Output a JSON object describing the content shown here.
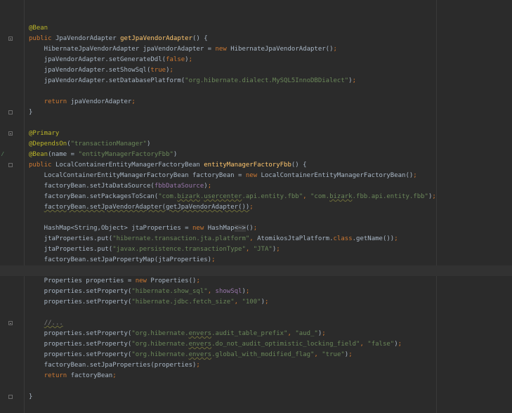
{
  "editor": {
    "lines": [
      {
        "fold": "none",
        "tokens": [
          {
            "t": "@Bean",
            "c": "a"
          }
        ]
      },
      {
        "fold": "open",
        "tokens": [
          {
            "t": "public ",
            "c": "k"
          },
          {
            "t": "JpaVendorAdapter ",
            "c": ""
          },
          {
            "t": "getJpaVendorAdapter",
            "c": "f"
          },
          {
            "t": "() {",
            "c": ""
          }
        ]
      },
      {
        "fold": "none",
        "tokens": [
          {
            "t": "    HibernateJpaVendorAdapter jpaVendorAdapter = ",
            "c": ""
          },
          {
            "t": "new ",
            "c": "k"
          },
          {
            "t": "HibernateJpaVendorAdapter()",
            "c": ""
          },
          {
            "t": ";",
            "c": "k"
          }
        ]
      },
      {
        "fold": "none",
        "tokens": [
          {
            "t": "    jpaVendorAdapter.setGenerateDdl(",
            "c": ""
          },
          {
            "t": "false",
            "c": "k"
          },
          {
            "t": ")",
            "c": ""
          },
          {
            "t": ";",
            "c": "k"
          }
        ]
      },
      {
        "fold": "none",
        "tokens": [
          {
            "t": "    jpaVendorAdapter.setShowSql(",
            "c": ""
          },
          {
            "t": "true",
            "c": "k"
          },
          {
            "t": ")",
            "c": ""
          },
          {
            "t": ";",
            "c": "k"
          }
        ]
      },
      {
        "fold": "none",
        "tokens": [
          {
            "t": "    jpaVendorAdapter.setDatabasePlatform(",
            "c": ""
          },
          {
            "t": "\"org.hibernate.dialect.MySQL5InnoDBDialect\"",
            "c": "s"
          },
          {
            "t": ")",
            "c": ""
          },
          {
            "t": ";",
            "c": "k"
          }
        ]
      },
      {
        "fold": "none",
        "tokens": []
      },
      {
        "fold": "none",
        "tokens": [
          {
            "t": "    ",
            "c": ""
          },
          {
            "t": "return ",
            "c": "k"
          },
          {
            "t": "jpaVendorAdapter",
            "c": ""
          },
          {
            "t": ";",
            "c": "k"
          }
        ]
      },
      {
        "fold": "close",
        "tokens": [
          {
            "t": "}",
            "c": ""
          }
        ]
      },
      {
        "fold": "none",
        "tokens": []
      },
      {
        "fold": "open",
        "tokens": [
          {
            "t": "@Primary",
            "c": "a"
          }
        ]
      },
      {
        "fold": "none",
        "tokens": [
          {
            "t": "@DependsOn",
            "c": "a"
          },
          {
            "t": "(",
            "c": ""
          },
          {
            "t": "\"transactionManager\"",
            "c": "s"
          },
          {
            "t": ")",
            "c": ""
          }
        ]
      },
      {
        "fold": "none",
        "vcs": true,
        "tokens": [
          {
            "t": "@Bean",
            "c": "a"
          },
          {
            "t": "(name = ",
            "c": ""
          },
          {
            "t": "\"entityManagerFactoryFbb\"",
            "c": "s"
          },
          {
            "t": ")",
            "c": ""
          }
        ]
      },
      {
        "fold": "close",
        "tokens": [
          {
            "t": "public ",
            "c": "k"
          },
          {
            "t": "LocalContainerEntityManagerFactoryBean ",
            "c": ""
          },
          {
            "t": "entityManagerFactoryFbb",
            "c": "f"
          },
          {
            "t": "() {",
            "c": ""
          }
        ]
      },
      {
        "fold": "none",
        "tokens": [
          {
            "t": "    LocalContainerEntityManagerFactoryBean factoryBean = ",
            "c": ""
          },
          {
            "t": "new ",
            "c": "k"
          },
          {
            "t": "LocalContainerEntityManagerFactoryBean()",
            "c": ""
          },
          {
            "t": ";",
            "c": "k"
          }
        ]
      },
      {
        "fold": "none",
        "tokens": [
          {
            "t": "    factoryBean.setJtaDataSource(",
            "c": ""
          },
          {
            "t": "fbbDataSource",
            "c": "v"
          },
          {
            "t": ")",
            "c": ""
          },
          {
            "t": ";",
            "c": "k"
          }
        ]
      },
      {
        "fold": "none",
        "tokens": [
          {
            "t": "    factoryBean.setPackagesToScan(",
            "c": ""
          },
          {
            "t": "\"com.",
            "c": "s"
          },
          {
            "t": "bizark",
            "c": "s u"
          },
          {
            "t": ".",
            "c": "s"
          },
          {
            "t": "usercenter",
            "c": "s u"
          },
          {
            "t": ".api.entity.fbb\"",
            "c": "s"
          },
          {
            "t": ", ",
            "c": "k"
          },
          {
            "t": "\"com.",
            "c": "s"
          },
          {
            "t": "bizark",
            "c": "s u"
          },
          {
            "t": ".fbb.api.entity.fbb\"",
            "c": "s"
          },
          {
            "t": ")",
            "c": ""
          },
          {
            "t": ";",
            "c": "k"
          }
        ]
      },
      {
        "fold": "none",
        "tokens": [
          {
            "t": "    ",
            "c": ""
          },
          {
            "t": "factoryBean.setJpaVendorAdapter(getJpaVendorAdapter())",
            "c": "u"
          },
          {
            "t": ";",
            "c": "k"
          }
        ]
      },
      {
        "fold": "none",
        "tokens": []
      },
      {
        "fold": "none",
        "tokens": [
          {
            "t": "    HashMap<String,Object> jtaProperties = ",
            "c": ""
          },
          {
            "t": "new ",
            "c": "k"
          },
          {
            "t": "HashMap",
            "c": ""
          },
          {
            "t": "<~>",
            "c": "hl"
          },
          {
            "t": "()",
            "c": ""
          },
          {
            "t": ";",
            "c": "k"
          }
        ]
      },
      {
        "fold": "none",
        "tokens": [
          {
            "t": "    jtaProperties.put(",
            "c": ""
          },
          {
            "t": "\"hibernate.transaction.jta.platform\"",
            "c": "s"
          },
          {
            "t": ", ",
            "c": "k"
          },
          {
            "t": "AtomikosJtaPlatform.",
            "c": ""
          },
          {
            "t": "class",
            "c": "k"
          },
          {
            "t": ".getName())",
            "c": ""
          },
          {
            "t": ";",
            "c": "k"
          }
        ]
      },
      {
        "fold": "none",
        "tokens": [
          {
            "t": "    jtaProperties.put(",
            "c": ""
          },
          {
            "t": "\"javax.persistence.transactionType\"",
            "c": "s"
          },
          {
            "t": ", ",
            "c": "k"
          },
          {
            "t": "\"JTA\"",
            "c": "s"
          },
          {
            "t": ")",
            "c": ""
          },
          {
            "t": ";",
            "c": "k"
          }
        ]
      },
      {
        "fold": "none",
        "tokens": [
          {
            "t": "    factoryBean.setJpaPropertyMap(jtaProperties)",
            "c": ""
          },
          {
            "t": ";",
            "c": "k"
          }
        ]
      },
      {
        "fold": "none",
        "current": true,
        "tokens": []
      },
      {
        "fold": "none",
        "tokens": [
          {
            "t": "    Properties properties = ",
            "c": ""
          },
          {
            "t": "new ",
            "c": "k"
          },
          {
            "t": "Properties()",
            "c": ""
          },
          {
            "t": ";",
            "c": "k"
          }
        ]
      },
      {
        "fold": "none",
        "tokens": [
          {
            "t": "    properties.setProperty(",
            "c": ""
          },
          {
            "t": "\"hibernate.show_sql\"",
            "c": "s"
          },
          {
            "t": ", ",
            "c": "k"
          },
          {
            "t": "showSql",
            "c": "v"
          },
          {
            "t": ")",
            "c": ""
          },
          {
            "t": ";",
            "c": "k"
          }
        ]
      },
      {
        "fold": "none",
        "tokens": [
          {
            "t": "    properties.setProperty(",
            "c": ""
          },
          {
            "t": "\"hibernate.jdbc.fetch_size\"",
            "c": "s"
          },
          {
            "t": ", ",
            "c": "k"
          },
          {
            "t": "\"100\"",
            "c": "s"
          },
          {
            "t": ")",
            "c": ""
          },
          {
            "t": ";",
            "c": "k"
          }
        ]
      },
      {
        "fold": "none",
        "tokens": []
      },
      {
        "fold": "open",
        "tokens": [
          {
            "t": "    ",
            "c": ""
          },
          {
            "t": "//...",
            "c": "c u"
          }
        ]
      },
      {
        "fold": "none",
        "tokens": [
          {
            "t": "    properties.setProperty(",
            "c": ""
          },
          {
            "t": "\"org.hibernate.",
            "c": "s"
          },
          {
            "t": "envers",
            "c": "s u"
          },
          {
            "t": ".audit_table_prefix\"",
            "c": "s"
          },
          {
            "t": ", ",
            "c": "k"
          },
          {
            "t": "\"aud_\"",
            "c": "s"
          },
          {
            "t": ")",
            "c": ""
          },
          {
            "t": ";",
            "c": "k"
          }
        ]
      },
      {
        "fold": "none",
        "tokens": [
          {
            "t": "    properties.setProperty(",
            "c": ""
          },
          {
            "t": "\"org.hibernate.",
            "c": "s"
          },
          {
            "t": "envers",
            "c": "s u"
          },
          {
            "t": ".do_not_audit_optimistic_locking_field\"",
            "c": "s"
          },
          {
            "t": ", ",
            "c": "k"
          },
          {
            "t": "\"false\"",
            "c": "s"
          },
          {
            "t": ")",
            "c": ""
          },
          {
            "t": ";",
            "c": "k"
          }
        ]
      },
      {
        "fold": "none",
        "tokens": [
          {
            "t": "    properties.setProperty(",
            "c": ""
          },
          {
            "t": "\"org.hibernate.",
            "c": "s"
          },
          {
            "t": "envers",
            "c": "s u"
          },
          {
            "t": ".global_with_modified_flag\"",
            "c": "s"
          },
          {
            "t": ", ",
            "c": "k"
          },
          {
            "t": "\"true\"",
            "c": "s"
          },
          {
            "t": ")",
            "c": ""
          },
          {
            "t": ";",
            "c": "k"
          }
        ]
      },
      {
        "fold": "none",
        "tokens": [
          {
            "t": "    factoryBean.setJpaProperties(properties)",
            "c": ""
          },
          {
            "t": ";",
            "c": "k"
          }
        ]
      },
      {
        "fold": "none",
        "tokens": [
          {
            "t": "    ",
            "c": ""
          },
          {
            "t": "return ",
            "c": "k"
          },
          {
            "t": "factoryBean",
            "c": ""
          },
          {
            "t": ";",
            "c": "k"
          }
        ]
      },
      {
        "fold": "none",
        "tokens": []
      },
      {
        "fold": "close",
        "tokens": [
          {
            "t": "}",
            "c": ""
          }
        ]
      }
    ]
  }
}
